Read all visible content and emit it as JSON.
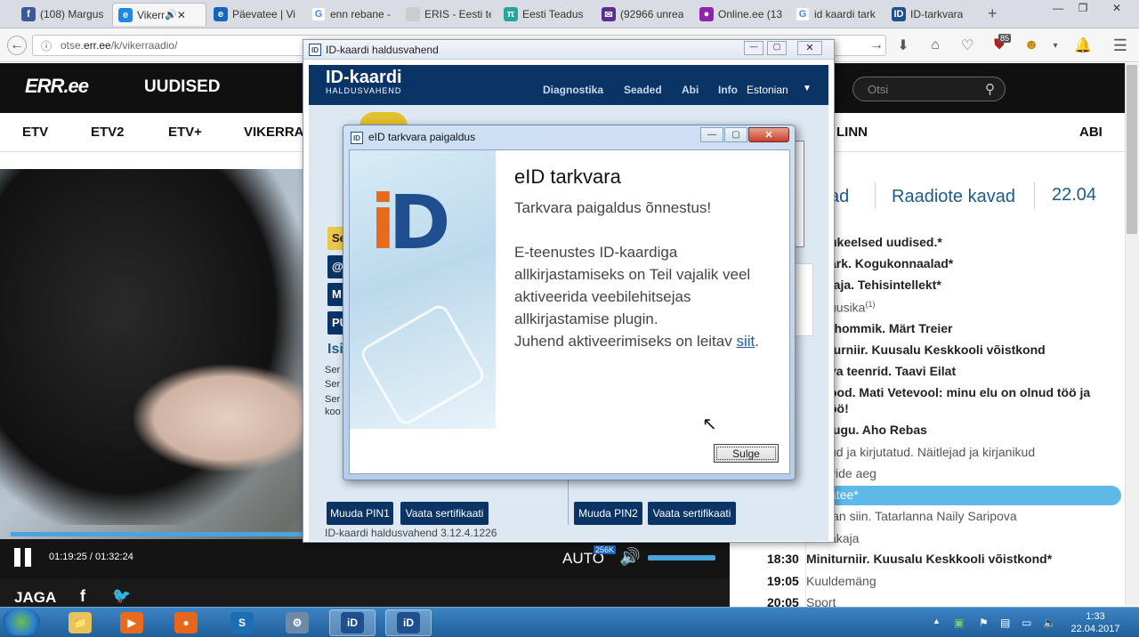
{
  "browser": {
    "tabs": [
      {
        "label": "(108) Margus",
        "icon": "facebook-icon",
        "color": "#3b5998",
        "glyph": "f"
      },
      {
        "label": "Vikerr",
        "icon": "err-icon",
        "color": "#1e88e5",
        "glyph": "e"
      },
      {
        "label": "Päevatee | Vi",
        "icon": "err-icon",
        "color": "#1565c0",
        "glyph": "e"
      },
      {
        "label": "enn rebane -",
        "icon": "google-icon",
        "color": "#ffffff",
        "glyph": "G"
      },
      {
        "label": "ERIS - Eesti teadu",
        "icon": "blank-icon",
        "color": "#cccccc",
        "glyph": ""
      },
      {
        "label": "Eesti Teadus",
        "icon": "etis-icon",
        "color": "#26a69a",
        "glyph": "π"
      },
      {
        "label": "(92966 unrea",
        "icon": "yahoo-mail-icon",
        "color": "#5c2d91",
        "glyph": "✉"
      },
      {
        "label": "Online.ee (13",
        "icon": "online-icon",
        "color": "#8e24aa",
        "glyph": "●"
      },
      {
        "label": "id kaardi tark",
        "icon": "google-icon",
        "color": "#ffffff",
        "glyph": "G"
      },
      {
        "label": "ID-tarkvara",
        "icon": "id-icon",
        "color": "#1f4f8f",
        "glyph": "ID"
      }
    ],
    "new_tab": "+",
    "url_prefix": "otse.",
    "url_domain": "err.ee",
    "url_path": "/k/vikerraadio/",
    "badge_count": "85"
  },
  "err": {
    "logo": "ERR.ee",
    "section": "UUDISED",
    "search_placeholder": "Otsi",
    "channels": [
      "ETV",
      "ETV2",
      "ETV+",
      "VIKERRA",
      "LINN",
      "ABI"
    ]
  },
  "player": {
    "time": "01:19:25 / 01:32:24",
    "quality": "AUTO",
    "bitrate": "256K",
    "share": "JAGA",
    "progress_fraction": 0.26
  },
  "schedule": {
    "tab_partial": "ad",
    "tab_title": "Raadiote kavad",
    "date": "22.04",
    "items": [
      {
        "time": "",
        "title": "ukeelsed uudised.*",
        "style": "b",
        "sup": ""
      },
      {
        "time": "",
        "title": "ark. Kogukonnaalad*",
        "style": "b",
        "sup": ""
      },
      {
        "time": "",
        "title": "taja. Tehisintellekt*",
        "style": "b",
        "sup": ""
      },
      {
        "time": "",
        "title": "uusika",
        "style": "g",
        "sup": "(1)"
      },
      {
        "time": "",
        "title": "rhommik. Märt Treier",
        "style": "b",
        "sup": ""
      },
      {
        "time": "",
        "title": "turniir. Kuusalu Keskkooli võistkond",
        "style": "b",
        "sup": ""
      },
      {
        "time": "",
        "title": "va teenrid. Taavi Eilat",
        "style": "b",
        "sup": ""
      },
      {
        "time": "",
        "title": "ood. Mati Vetevool: minu elu on olnud töö ja",
        "style": "b",
        "sup": ""
      },
      {
        "time": "",
        "title": "öö!",
        "style": "b",
        "sup": ""
      },
      {
        "time": "",
        "title": "lugu. Aho Rebas",
        "style": "b",
        "sup": ""
      },
      {
        "time": "",
        "title": "ud ja kirjutatud. Näitlejad ja kirjanikud",
        "style": "g",
        "sup": ""
      },
      {
        "time": "",
        "title": "vide aeg",
        "style": "g",
        "sup": ""
      },
      {
        "time": "",
        "title": "atee*",
        "style": "hl",
        "sup": ""
      },
      {
        "time": "",
        "title": "lan siin. Tatarlanna Naily Saripova",
        "style": "g",
        "sup": ""
      },
      {
        "time": "",
        "title": "akaja",
        "style": "g",
        "sup": ""
      },
      {
        "time": "18:30",
        "title": "Miniturniir. Kuusalu Keskkooli võistkond*",
        "style": "b",
        "sup": ""
      },
      {
        "time": "19:05",
        "title": "Kuuldemäng",
        "style": "g",
        "sup": ""
      },
      {
        "time": "20:05",
        "title": "Sport",
        "style": "g",
        "sup": ""
      }
    ]
  },
  "idwindow": {
    "title": "ID-kaardi haldusvahend",
    "logo_main": "ID-kaardi",
    "logo_sub": "HALDUSVAHEND",
    "menu": [
      "Diagnostika",
      "Seaded",
      "Abi",
      "Info",
      "Estonian"
    ],
    "side_labels": [
      "Se",
      "@",
      "M",
      "PU"
    ],
    "section": "Isi",
    "small_lines": [
      "Ser",
      "Ser",
      "Ser",
      "koo"
    ],
    "buttons": [
      "Muuda PIN1",
      "Vaata sertifikaati",
      "Muuda PIN2",
      "Vaata sertifikaati"
    ],
    "version": "ID-kaardi haldusvahend 3.12.4.1226"
  },
  "dialog": {
    "title": "eID tarkvara paigaldus",
    "heading": "eID tarkvara",
    "success": "Tarkvara paigaldus õnnestus!",
    "lines": [
      "E-teenustes ID-kaardiga",
      "allkirjastamiseks on Teil vajalik veel",
      "aktiveerida veebilehitsejas",
      "allkirjastamise plugin."
    ],
    "guide_text": "Juhend aktiveerimiseks on leitav ",
    "guide_link": "siit",
    "guide_end": ".",
    "close_button": "Sulge",
    "logo": "iD"
  },
  "taskbar": {
    "apps": [
      {
        "name": "explorer",
        "glyph": "📁",
        "color": "#e8c25a"
      },
      {
        "name": "media-player",
        "glyph": "▶",
        "color": "#e86a1c"
      },
      {
        "name": "firefox",
        "glyph": "●",
        "color": "#e8651c"
      },
      {
        "name": "skype-app",
        "glyph": "S",
        "color": "#1d6fb5"
      },
      {
        "name": "network-app",
        "glyph": "⚙",
        "color": "#6e8aa6"
      },
      {
        "name": "id-card-app",
        "glyph": "iD",
        "color": "#1f4f8f"
      },
      {
        "name": "id-utility-app",
        "glyph": "iD",
        "color": "#1f4f8f"
      }
    ],
    "time": "1:33",
    "date": "22.04.2017"
  }
}
